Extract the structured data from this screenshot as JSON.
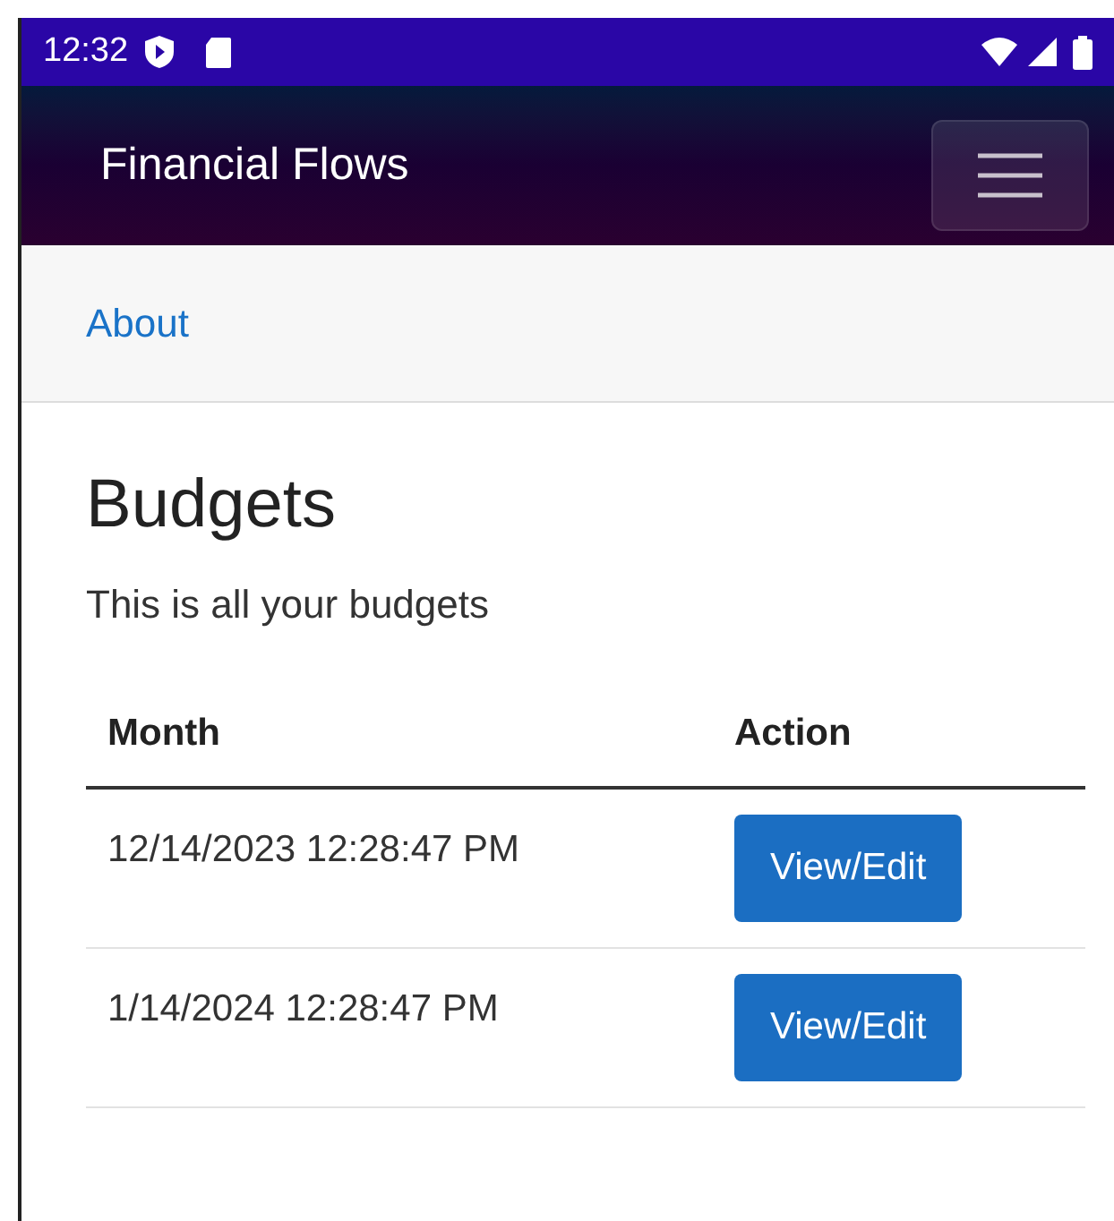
{
  "status_bar": {
    "time": "12:32"
  },
  "app_bar": {
    "title": "Financial Flows"
  },
  "nav": {
    "links": [
      "About"
    ]
  },
  "page": {
    "heading": "Budgets",
    "subtitle": "This is all your budgets"
  },
  "table": {
    "columns": [
      "Month",
      "Action"
    ],
    "rows": [
      {
        "month": "12/14/2023 12:28:47 PM",
        "action": "View/Edit"
      },
      {
        "month": "1/14/2024 12:28:47 PM",
        "action": "View/Edit"
      }
    ]
  }
}
